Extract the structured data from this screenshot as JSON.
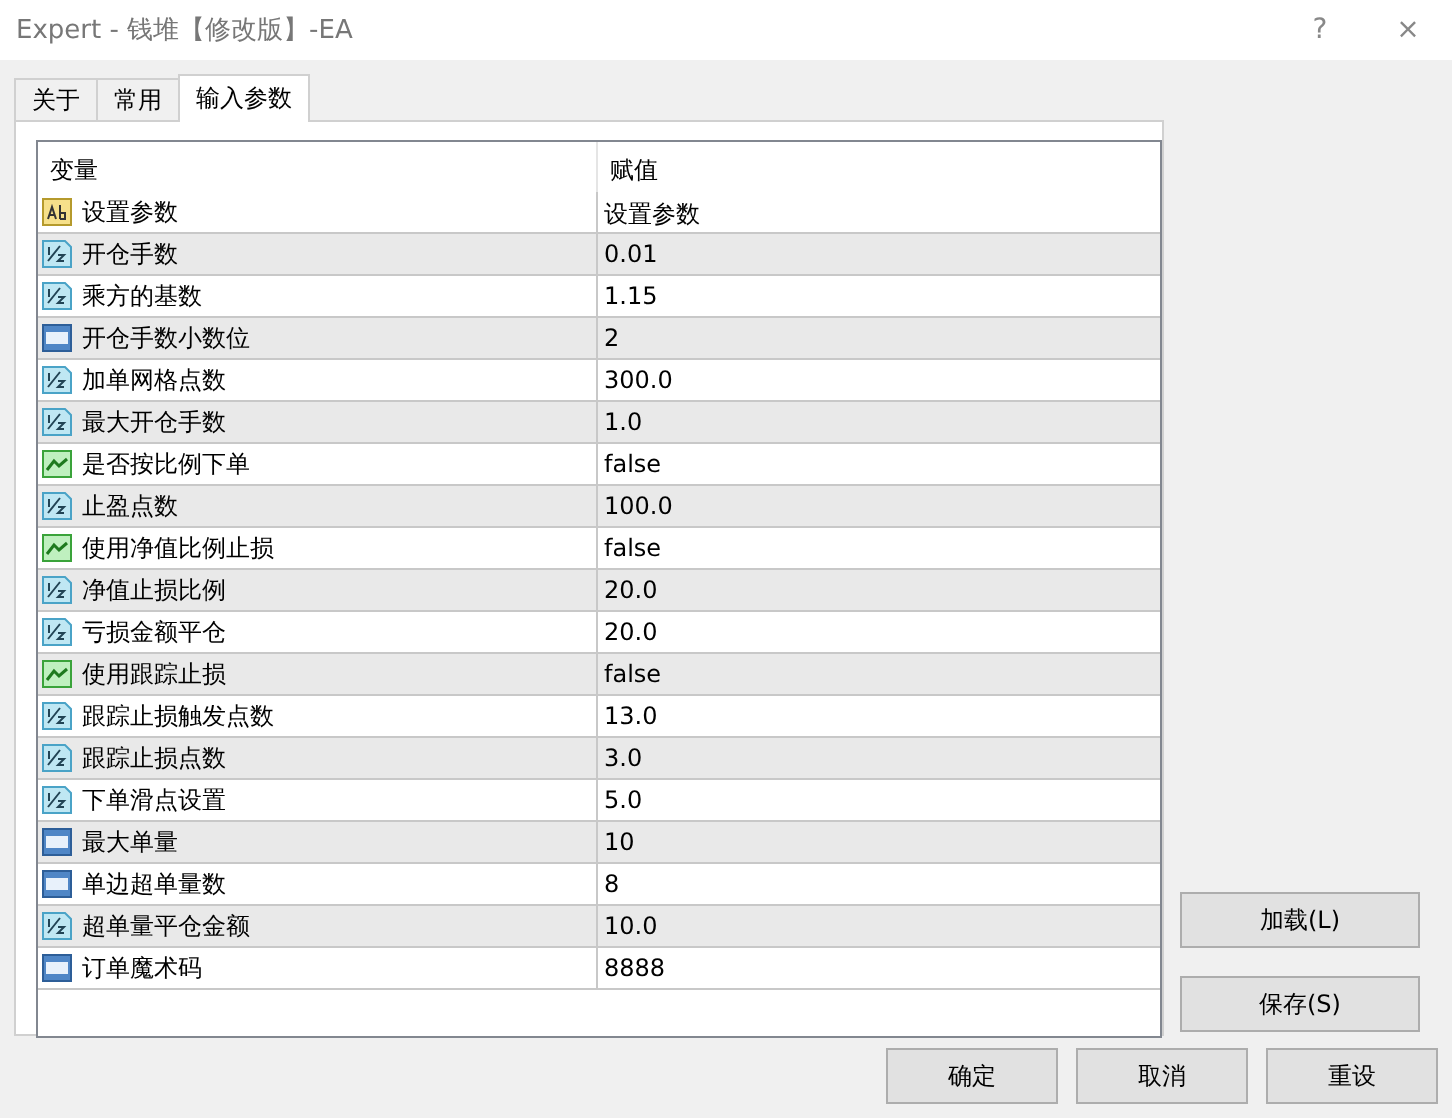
{
  "window": {
    "title": "Expert - 钱堆【修改版】-EA",
    "help": "?",
    "close": "×"
  },
  "tabs": [
    {
      "label": "关于",
      "selected": false
    },
    {
      "label": "常用",
      "selected": false
    },
    {
      "label": "输入参数",
      "selected": true
    }
  ],
  "table": {
    "columns": [
      "变量",
      "赋值"
    ],
    "rows": [
      {
        "kind": "string",
        "name": "设置参数",
        "value": "设置参数"
      },
      {
        "kind": "double",
        "name": "开仓手数",
        "value": "0.01"
      },
      {
        "kind": "double",
        "name": "乘方的基数",
        "value": "1.15"
      },
      {
        "kind": "int",
        "name": "开仓手数小数位",
        "value": "2"
      },
      {
        "kind": "double",
        "name": "加单网格点数",
        "value": "300.0"
      },
      {
        "kind": "double",
        "name": "最大开仓手数",
        "value": "1.0"
      },
      {
        "kind": "bool",
        "name": "是否按比例下单",
        "value": "false"
      },
      {
        "kind": "double",
        "name": "止盈点数",
        "value": "100.0"
      },
      {
        "kind": "bool",
        "name": "使用净值比例止损",
        "value": "false"
      },
      {
        "kind": "double",
        "name": "净值止损比例",
        "value": "20.0"
      },
      {
        "kind": "double",
        "name": "亏损金额平仓",
        "value": "20.0"
      },
      {
        "kind": "bool",
        "name": "使用跟踪止损",
        "value": "false"
      },
      {
        "kind": "double",
        "name": "跟踪止损触发点数",
        "value": "13.0"
      },
      {
        "kind": "double",
        "name": "跟踪止损点数",
        "value": "3.0"
      },
      {
        "kind": "double",
        "name": "下单滑点设置",
        "value": "5.0"
      },
      {
        "kind": "int",
        "name": "最大单量",
        "value": "10"
      },
      {
        "kind": "int",
        "name": "单边超单量数",
        "value": "8"
      },
      {
        "kind": "double",
        "name": "超单量平仓金额",
        "value": "10.0"
      },
      {
        "kind": "int",
        "name": "订单魔术码",
        "value": "8888"
      }
    ]
  },
  "side_buttons": [
    "加载(L)",
    "保存(S)"
  ],
  "buttons": [
    "确定",
    "取消",
    "重设"
  ]
}
